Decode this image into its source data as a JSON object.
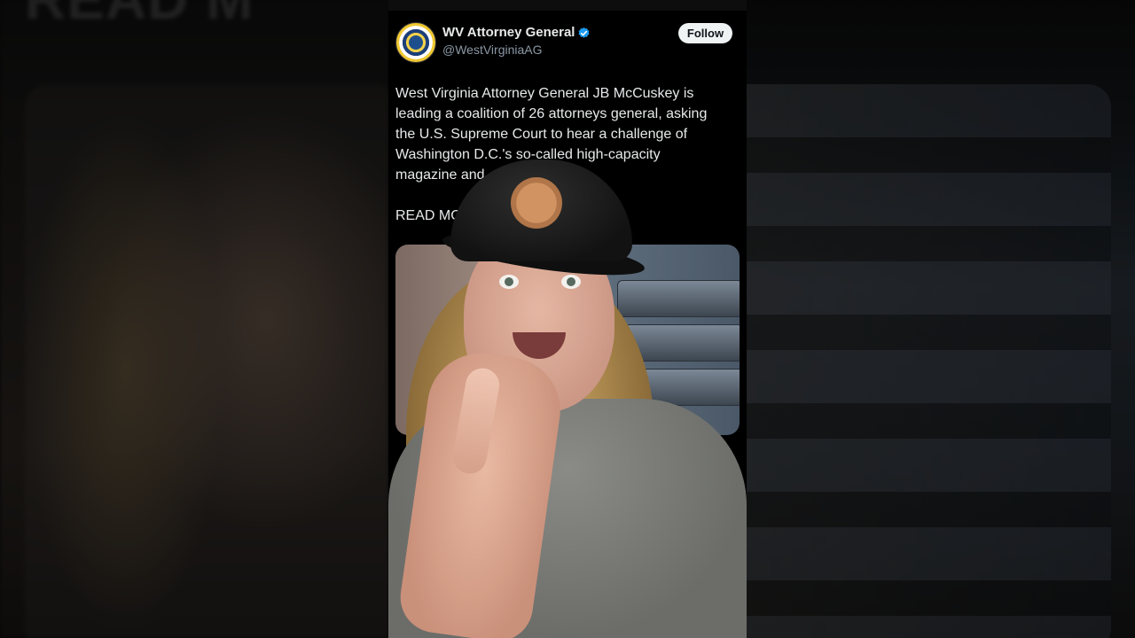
{
  "background": {
    "left_text": "READ M"
  },
  "post": {
    "account_name": "WV Attorney General",
    "handle": "@WestVirginiaAG",
    "follow_label": "Follow",
    "text_lines": [
      "West Virginia Attorney General JB McCuskey is",
      "leading a coalition of 26 attorneys general, asking",
      "the U.S. Supreme Court to hear a challenge of",
      "Washington D.C.'s so-called high-capacity",
      "magazine and ... weapons ban."
    ],
    "read_more": "READ MO",
    "icons": {
      "verified": "verified-badge-icon",
      "share": "share-icon"
    },
    "colors": {
      "verified": "#1d9bf0",
      "text": "#e7e9ea",
      "handle": "#8b98a5"
    }
  }
}
